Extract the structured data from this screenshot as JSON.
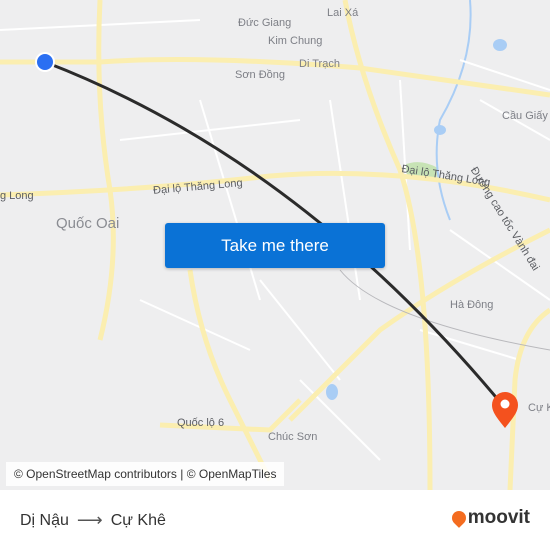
{
  "map": {
    "labels": {
      "lai_xa": "Lai Xá",
      "duc_giang": "Đức Giang",
      "kim_chung": "Kim Chung",
      "di_trach": "Di Trạch",
      "son_dong": "Sơn Đồng",
      "cau_giay": "Cầu Giấy",
      "duong_cao_toc": "Đường cao tốc Vành đai",
      "dai_lo_left": "Đại lộ Thăng Long",
      "dai_lo_right": "Đại lộ Thăng Long",
      "long_edge": "g Long",
      "quoc_oai": "Quốc Oai",
      "ha_dong": "Hà Đông",
      "cu_khe": "Cự K",
      "quoc_lo_6": "Quốc lộ 6",
      "chuc_son": "Chúc Sơn"
    },
    "origin_color": "#2a6ff2",
    "destination_color": "#f4511e",
    "route_color": "#2b2b2b",
    "attribution": "© OpenStreetMap contributors | © OpenMapTiles"
  },
  "cta": {
    "label": "Take me there",
    "color": "#0a72d6"
  },
  "footer": {
    "origin": "Dị Nậu",
    "arrow": "⟶",
    "destination": "Cự Khê",
    "logo_text": "moovit",
    "logo_color": "#f46c1f"
  }
}
